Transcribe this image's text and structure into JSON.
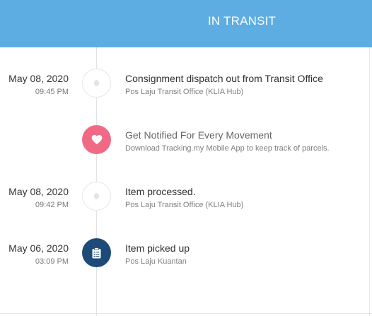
{
  "header": {
    "title": "IN TRANSIT",
    "bg_color": "#5dade2"
  },
  "events": [
    {
      "date": "May 08, 2020",
      "time": "09:45 PM",
      "title": "Consignment dispatch out from Transit Office",
      "location": "Pos Laju Transit Office (KLIA Hub)",
      "icon": "dot-icon"
    },
    {
      "title": "Get Notified For Every Movement",
      "location": "Download Tracking.my Mobile App to keep track of parcels.",
      "icon": "heart-icon",
      "icon_color": "#f06a86"
    },
    {
      "date": "May 08, 2020",
      "time": "09:42 PM",
      "title": "Item processed.",
      "location": "Pos Laju Transit Office (KLIA Hub)",
      "icon": "dot-icon"
    },
    {
      "date": "May 06, 2020",
      "time": "03:09 PM",
      "title": "Item picked up",
      "location": "Pos Laju Kuantan",
      "icon": "clipboard-icon",
      "icon_color": "#1e4a7a"
    }
  ]
}
